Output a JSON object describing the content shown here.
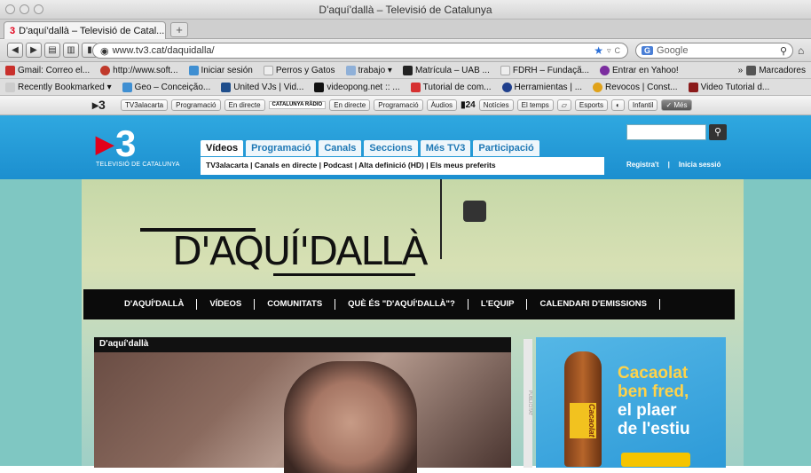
{
  "window": {
    "title": "D'aquí'dallà – Televisió de Catalunya"
  },
  "tab": {
    "label": "D'aquí'dallà – Televisió de Catal...",
    "favicon": "3",
    "close": "×",
    "new": "+"
  },
  "nav": {
    "url": "www.tv3.cat/daquidalla/",
    "search_placeholder": "Google",
    "search_engine": "G"
  },
  "bookmarks1": [
    {
      "label": "Gmail: Correo el...",
      "icon_color": "#c9302c"
    },
    {
      "label": "http://www.soft...",
      "icon_color": "#c0392b"
    },
    {
      "label": "Iniciar sesión",
      "icon_color": "#3f8fd2"
    },
    {
      "label": "Perros y Gatos",
      "icon_color": "#dddddd"
    },
    {
      "label": "trabajo ▾",
      "icon_color": "#8fb0d8"
    },
    {
      "label": "Matrícula – UAB ...",
      "icon_color": "#222222"
    },
    {
      "label": "FDRH – Fundaçã...",
      "icon_color": "#dddddd"
    },
    {
      "label": "Entrar en Yahoo!",
      "icon_color": "#7b2d9f"
    }
  ],
  "bookmarks1_right": {
    "chevron": "»",
    "label": "Marcadores"
  },
  "bookmarks2": [
    {
      "label": "Recently Bookmarked ▾",
      "icon_color": "#cccccc"
    },
    {
      "label": "Geo – Conceição...",
      "icon_color": "#3f8fd2"
    },
    {
      "label": "United VJs | Vid...",
      "icon_color": "#1f4e8c"
    },
    {
      "label": "videopong.net :: ...",
      "icon_color": "#111111"
    },
    {
      "label": "Tutorial de com...",
      "icon_color": "#d63031"
    },
    {
      "label": "Herramientas | ...",
      "icon_color": "#1f3f8c"
    },
    {
      "label": "Revocos | Const...",
      "icon_color": "#e0a21a"
    },
    {
      "label": "Video Tutorial d...",
      "icon_color": "#8b1a1a"
    }
  ],
  "tvbar": {
    "logo": "▸3",
    "left": [
      "TV3alacarta",
      "Programació",
      "En directe"
    ],
    "radio": "CATALUNYA RÀDIO",
    "mid": [
      "En directe",
      "Programació",
      "Àudios"
    ],
    "e24": "24",
    "right": [
      "Notícies",
      "El temps",
      "Esports",
      "Infantil",
      "Més"
    ]
  },
  "header": {
    "logo": "3",
    "logo_sub": "TELEVISIÓ DE CATALUNYA",
    "tabs": [
      "Vídeos",
      "Programació",
      "Canals",
      "Seccions",
      "Més TV3",
      "Participació"
    ],
    "submenu": "TV3alacarta | Canals en directe | Podcast | Alta definició (HD) | Els meus preferits",
    "register": "Registra't",
    "sep": "|",
    "login": "Inicia sessió"
  },
  "banner": {
    "title": "D'AQUÍ'DALLÀ",
    "nav": [
      "D'AQUÍ'DALLÀ",
      "VÍDEOS",
      "COMUNITATS",
      "QUÈ ÉS \"D'AQUÍ'DALLÀ\"?",
      "L'EQUIP",
      "CALENDARI D'EMISSIONS"
    ],
    "section": "D'aquí'dallà",
    "strip": "PUBLICITAT"
  },
  "ad": {
    "brand": "Cacaolat",
    "line1": "Cacaolat",
    "line2": "ben fred,",
    "line3": "el plaer",
    "line4": "de l'estiu"
  }
}
